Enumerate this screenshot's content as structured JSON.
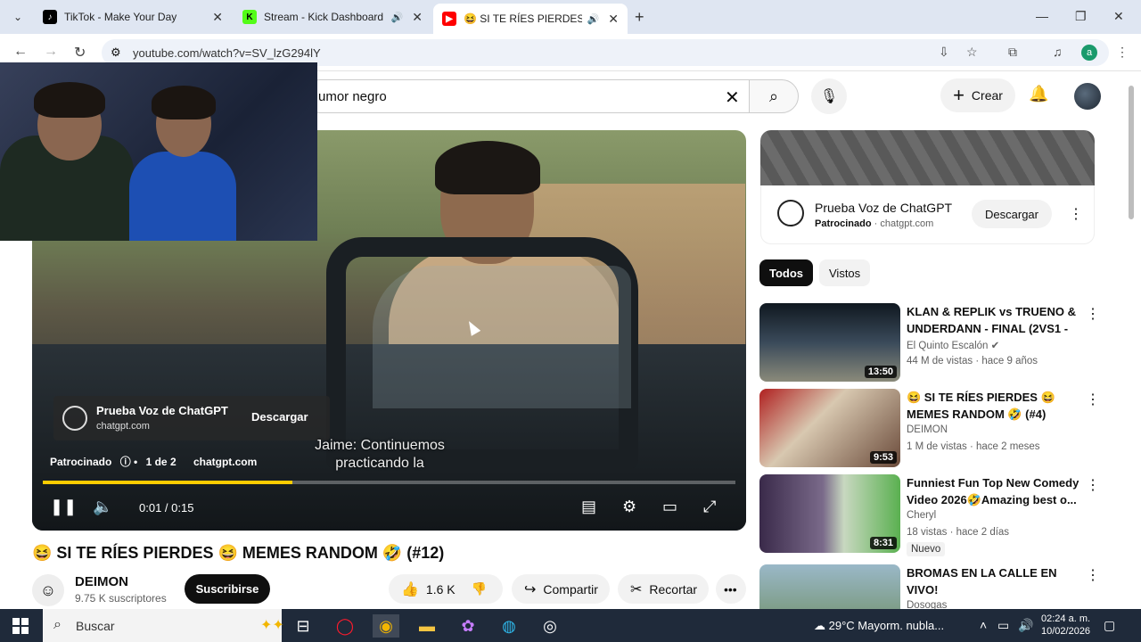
{
  "browser": {
    "tabs": [
      {
        "title": "TikTok - Make Your Day",
        "favicon": "tiktok-icon",
        "color": "#000000"
      },
      {
        "title": "Stream - Kick Dashboard",
        "favicon": "kick-icon",
        "color": "#53fc18"
      },
      {
        "title": "😆 SI TE RÍES PIERDES 😆 M",
        "favicon": "youtube-icon",
        "color": "#ff0000"
      }
    ],
    "url": "youtube.com/watch?v=SV_lzG294lY",
    "profile_initial": "a"
  },
  "youtube": {
    "search_query": "umor negro",
    "create_label": "Crear"
  },
  "player": {
    "ad": {
      "title": "Prueba Voz de ChatGPT",
      "domain": "chatgpt.com",
      "cta": "Descargar",
      "sponsored": "Patrocinado",
      "count": "1 de 2"
    },
    "subtitle": "Jaime: Continuemos practicando la",
    "time": "0:01 / 0:15",
    "progress": 0.36
  },
  "video": {
    "title": "😆 SI TE RÍES PIERDES 😆 MEMES RANDOM 🤣 (#12)",
    "channel": "DEIMON",
    "subscribers": "9.75 K suscriptores",
    "subscribe_label": "Suscribirse",
    "likes": "1.6 K",
    "share_label": "Compartir",
    "clip_label": "Recortar"
  },
  "sidebar": {
    "ad": {
      "title": "Prueba Voz de ChatGPT",
      "sponsored": "Patrocinado",
      "domain": "chatgpt.com",
      "cta": "Descargar"
    },
    "chips": [
      "Todos",
      "Vistos"
    ],
    "recommendations": [
      {
        "title": "KLAN & REPLIK vs TRUENO & UNDERDANN - FINAL (2VS1 - ...",
        "channel": "El Quinto Escalón",
        "meta": "44 M de vistas · hace 9 años",
        "duration": "13:50",
        "badge": ""
      },
      {
        "title": "😆 SI TE RÍES PIERDES 😆 MEMES RANDOM 🤣 (#4)",
        "channel": "DEIMON",
        "meta": "1 M de vistas · hace 2 meses",
        "duration": "9:53",
        "badge": ""
      },
      {
        "title": "Funniest Fun Top New Comedy Video 2026🤣Amazing best o...",
        "channel": "Cheryl",
        "meta": "18 vistas · hace 2 días",
        "duration": "8:31",
        "badge": "Nuevo"
      },
      {
        "title": "BROMAS EN LA CALLE EN VIVO!",
        "channel": "Dosogas",
        "meta": "",
        "duration": "",
        "badge": ""
      }
    ]
  },
  "taskbar": {
    "search_placeholder": "Buscar",
    "weather": "29°C  Mayorm. nubla...",
    "time": "02:24 a. m.",
    "date": "10/02/2026"
  }
}
